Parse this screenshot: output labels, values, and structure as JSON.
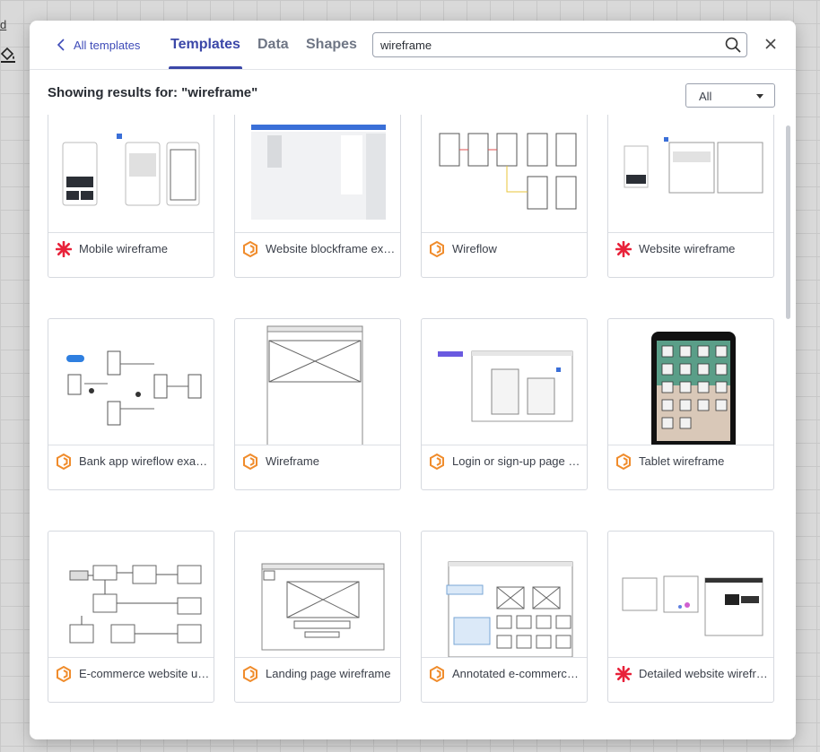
{
  "background": {
    "left_label": "d"
  },
  "header": {
    "back_label": "All templates",
    "tabs": [
      {
        "label": "Templates",
        "active": true
      },
      {
        "label": "Data",
        "active": false
      },
      {
        "label": "Shapes",
        "active": false
      }
    ],
    "search": {
      "value": "wireframe",
      "placeholder": ""
    }
  },
  "results": {
    "heading": "Showing results for: \"wireframe\"",
    "filter": {
      "selected": "All"
    }
  },
  "colors": {
    "accent": "#3b47a8",
    "lucid_orange": "#f08c2c",
    "red_asterisk": "#e8223a"
  },
  "templates": [
    {
      "label": "Mobile wireframe",
      "icon": "lucidspark-icon"
    },
    {
      "label": "Website blockframe exa...",
      "icon": "lucidchart-icon"
    },
    {
      "label": "Wireflow",
      "icon": "lucidchart-icon"
    },
    {
      "label": "Website wireframe",
      "icon": "lucidspark-icon"
    },
    {
      "label": "Bank app wireflow exam...",
      "icon": "lucidchart-icon"
    },
    {
      "label": "Wireframe",
      "icon": "lucidchart-icon"
    },
    {
      "label": "Login or sign-up page w...",
      "icon": "lucidchart-icon"
    },
    {
      "label": "Tablet wireframe",
      "icon": "lucidchart-icon"
    },
    {
      "label": "E-commerce website us...",
      "icon": "lucidchart-icon"
    },
    {
      "label": "Landing page wireframe",
      "icon": "lucidchart-icon"
    },
    {
      "label": "Annotated e-commerce ...",
      "icon": "lucidchart-icon"
    },
    {
      "label": "Detailed website wirefra...",
      "icon": "lucidspark-icon"
    }
  ]
}
